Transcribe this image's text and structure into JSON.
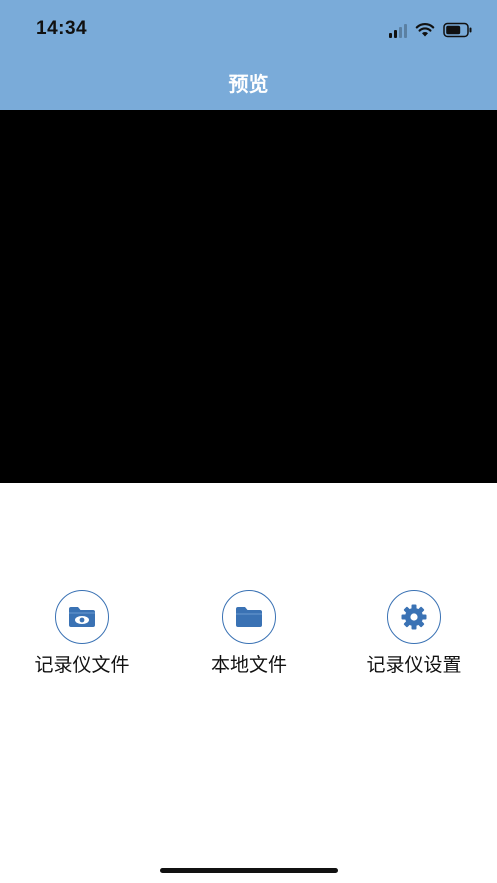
{
  "status_bar": {
    "time": "14:34"
  },
  "header": {
    "title": "预览",
    "background": "#7aabd9"
  },
  "preview": {
    "background": "#000000"
  },
  "actions": [
    {
      "label": "记录仪文件",
      "icon": "folder-eye-icon"
    },
    {
      "label": "本地文件",
      "icon": "folder-icon"
    },
    {
      "label": "记录仪设置",
      "icon": "gear-icon"
    }
  ],
  "colors": {
    "accent": "#3a72b4"
  }
}
